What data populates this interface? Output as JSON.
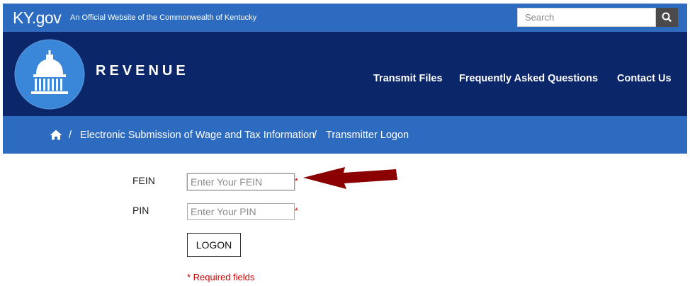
{
  "topbar": {
    "brand": "KY.gov",
    "tagline": "An Official Website of the Commonwealth of Kentucky",
    "search_placeholder": "Search",
    "search_icon": "search-icon"
  },
  "header": {
    "agency": "REVENUE",
    "nav": [
      "Transmit Files",
      "Frequently Asked Questions",
      "Contact Us"
    ]
  },
  "breadcrumb": {
    "home_icon": "home-icon",
    "separator": "/",
    "items": [
      "Electronic Submission of Wage and Tax Information",
      "Transmitter Logon"
    ]
  },
  "form": {
    "fein_label": "FEIN",
    "fein_placeholder": "Enter Your FEIN",
    "pin_label": "PIN",
    "pin_placeholder": "Enter Your PIN",
    "required_mark": "*",
    "logon_label": "LOGON",
    "required_note": "* Required fields"
  },
  "colors": {
    "blue_bar": "#2c6bc0",
    "navy_header": "#0b2769",
    "required_red": "#cc0000",
    "annotation_arrow": "#8b0000"
  }
}
